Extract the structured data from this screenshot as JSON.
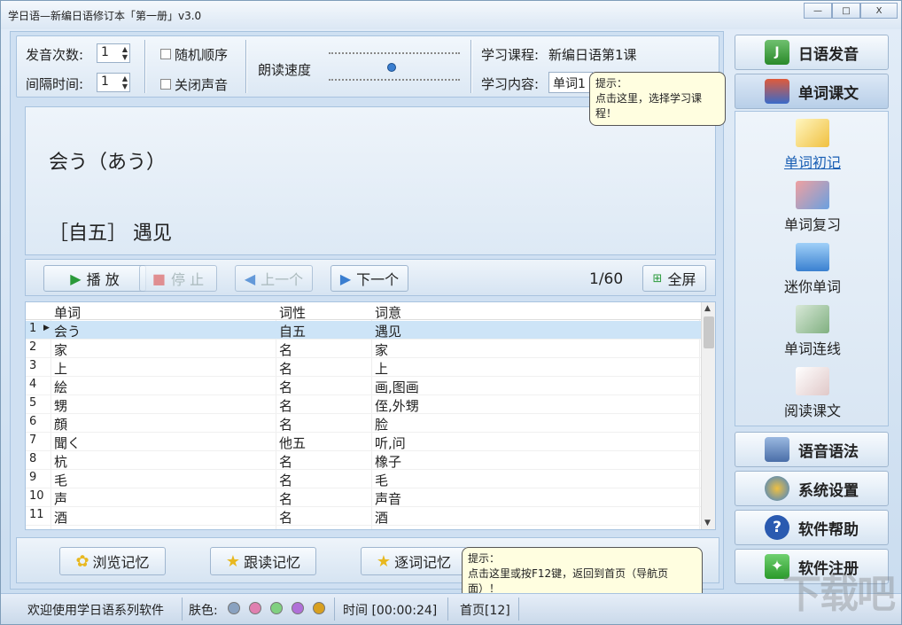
{
  "window": {
    "title": "学日语—新编日语修订本「第一册」v3.0",
    "buttons": [
      "—",
      "□",
      "X"
    ]
  },
  "settings": {
    "repeat_label": "发音次数:",
    "repeat_value": "1",
    "interval_label": "间隔时间:",
    "interval_value": "1",
    "random_label": "随机顺序",
    "mute_label": "关闭声音",
    "speed_label": "朗读速度",
    "course_label": "学习课程:",
    "course_value": "新编日语第1课",
    "content_label": "学习内容:",
    "content_value": "单词1"
  },
  "display": {
    "word": "会う（あう）",
    "meaning": "［自五］ 遇见"
  },
  "toolbar": {
    "play": "播 放",
    "stop": "停 止",
    "prev": "上一个",
    "next": "下一个",
    "counter": "1/60",
    "fullscreen": "全屏"
  },
  "grid": {
    "headers": [
      "单词",
      "词性",
      "词意"
    ],
    "rows": [
      {
        "n": "1",
        "word": "会う",
        "pos": "自五",
        "meaning": "遇见"
      },
      {
        "n": "2",
        "word": "家",
        "pos": "名",
        "meaning": "家"
      },
      {
        "n": "3",
        "word": "上",
        "pos": "名",
        "meaning": "上"
      },
      {
        "n": "4",
        "word": "絵",
        "pos": "名",
        "meaning": "画,图画"
      },
      {
        "n": "5",
        "word": "甥",
        "pos": "名",
        "meaning": "侄,外甥"
      },
      {
        "n": "6",
        "word": "顔",
        "pos": "名",
        "meaning": "脸"
      },
      {
        "n": "7",
        "word": "聞く",
        "pos": "他五",
        "meaning": "听,问"
      },
      {
        "n": "8",
        "word": "杭",
        "pos": "名",
        "meaning": "橡子"
      },
      {
        "n": "9",
        "word": "毛",
        "pos": "名",
        "meaning": "毛"
      },
      {
        "n": "10",
        "word": "声",
        "pos": "名",
        "meaning": "声音"
      },
      {
        "n": "11",
        "word": "酒",
        "pos": "名",
        "meaning": "酒"
      }
    ]
  },
  "bottom": {
    "browse": "浏览记忆",
    "follow": "跟读记忆",
    "each": "逐词记忆"
  },
  "sidebar": {
    "pronunciation": "日语发音",
    "vocab": "单词课文",
    "sub": [
      "单词初记",
      "单词复习",
      "迷你单词",
      "单词连线",
      "阅读课文"
    ],
    "grammar": "语音语法",
    "settings": "系统设置",
    "help": "软件帮助",
    "register": "软件注册"
  },
  "tips": {
    "tip1_title": "提示：",
    "tip1_text": "点击这里，选择学习课程！",
    "tip2_title": "提示：",
    "tip2_text": "点击这里或按F12键，返回到首页（导航页面）！"
  },
  "status": {
    "welcome": "欢迎使用学日语系列软件",
    "skin_label": "肤色:",
    "skin_colors": [
      "#8aa2c0",
      "#e080b0",
      "#80d080",
      "#b070d8",
      "#d8a020"
    ],
    "time": "时间 [00:00:24]",
    "home": "首页[12]"
  }
}
